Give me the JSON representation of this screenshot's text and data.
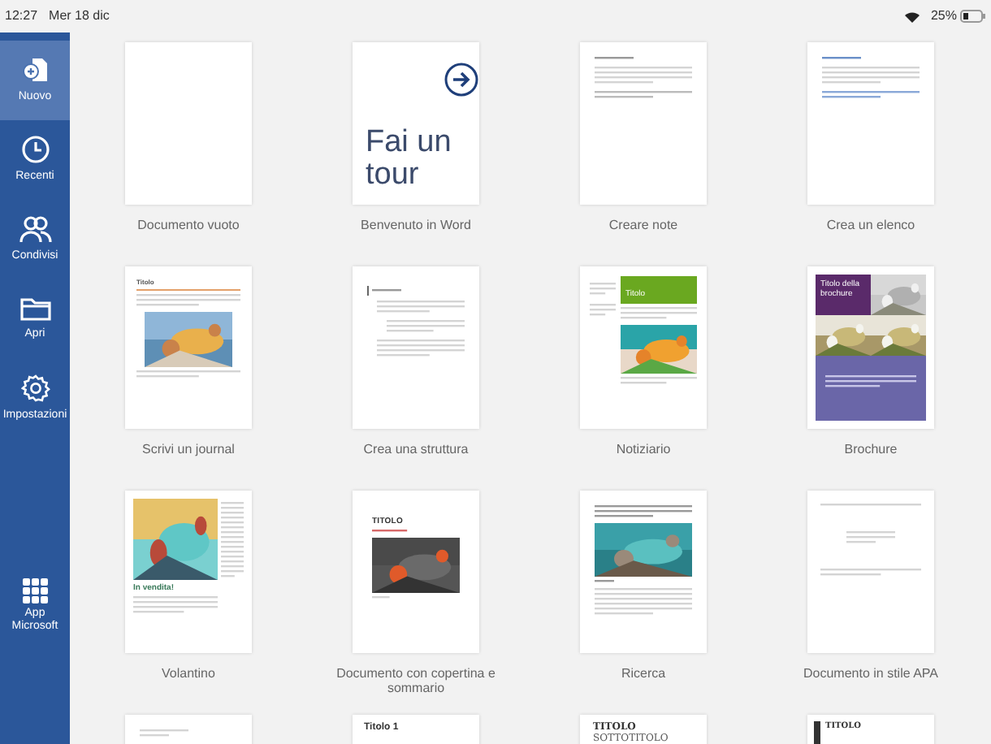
{
  "status_bar": {
    "time": "12:27",
    "date": "Mer 18 dic",
    "battery": "25%"
  },
  "sidebar": {
    "items": [
      {
        "label": "Nuovo",
        "selected": true
      },
      {
        "label": "Recenti",
        "selected": false
      },
      {
        "label": "Condivisi",
        "selected": false
      },
      {
        "label": "Apri",
        "selected": false
      },
      {
        "label": "Impostazioni",
        "selected": false
      }
    ],
    "footer_item": {
      "label": "App\nMicrosoft",
      "selected": false
    }
  },
  "templates": [
    {
      "label": "Documento vuoto",
      "preview": {
        "kind": "blank"
      }
    },
    {
      "label": "Benvenuto in Word",
      "preview": {
        "kind": "tour",
        "title": "Fai un tour"
      }
    },
    {
      "label": "Creare note",
      "preview": {
        "kind": "notes"
      }
    },
    {
      "label": "Crea un elenco",
      "preview": {
        "kind": "list"
      }
    },
    {
      "label": "Scrivi un journal",
      "preview": {
        "kind": "journal",
        "title": "Titolo"
      }
    },
    {
      "label": "Crea una struttura",
      "preview": {
        "kind": "outline"
      }
    },
    {
      "label": "Notiziario",
      "preview": {
        "kind": "newsletter",
        "title": "Titolo"
      }
    },
    {
      "label": "Brochure",
      "preview": {
        "kind": "brochure",
        "title": "Titolo della brochure"
      }
    },
    {
      "label": "Volantino",
      "preview": {
        "kind": "flyer",
        "title": "In vendita!"
      }
    },
    {
      "label": "Documento con copertina e sommario",
      "preview": {
        "kind": "cover",
        "title": "TITOLO"
      }
    },
    {
      "label": "Ricerca",
      "preview": {
        "kind": "research"
      }
    },
    {
      "label": "Documento in stile APA",
      "preview": {
        "kind": "apa"
      }
    },
    {
      "preview": {
        "kind": "letter"
      }
    },
    {
      "preview": {
        "kind": "heading",
        "title": "Titolo 1"
      }
    },
    {
      "preview": {
        "kind": "title",
        "title": "TITOLO",
        "subtitle": "SOTTOTITOLO"
      }
    },
    {
      "preview": {
        "kind": "titlebar",
        "title": "TITOLO"
      }
    }
  ]
}
